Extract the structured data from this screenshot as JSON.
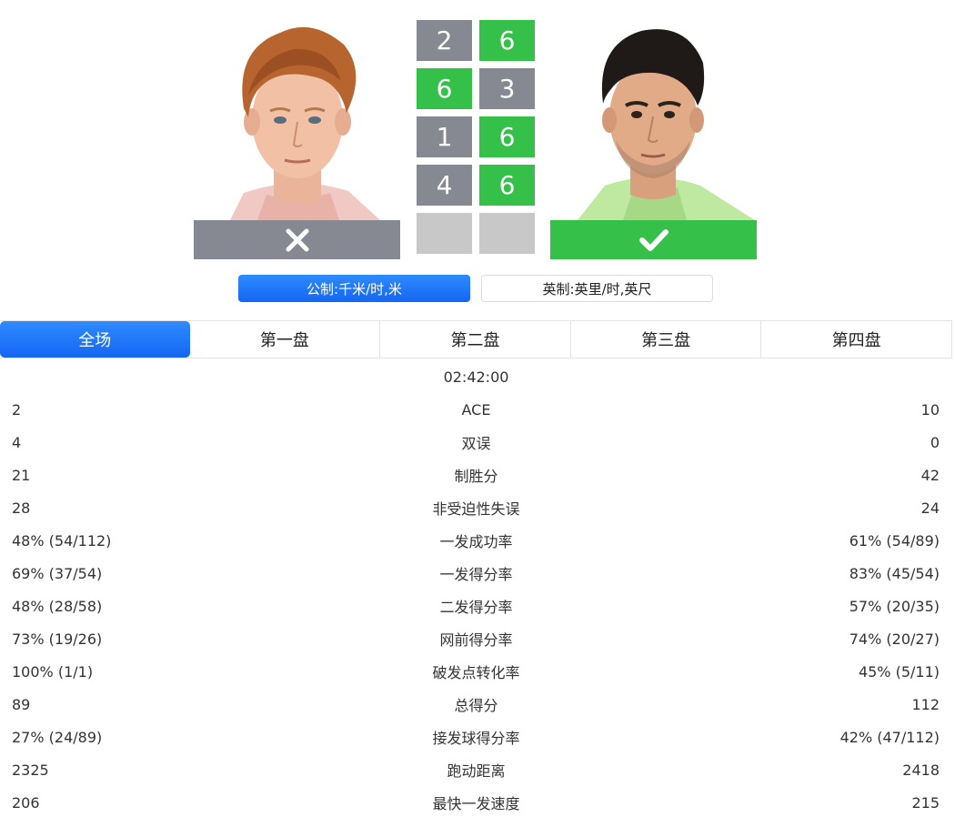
{
  "players": {
    "left": {
      "result": "loss",
      "result_icon": "close-icon"
    },
    "right": {
      "result": "win",
      "result_icon": "check-icon"
    }
  },
  "sets": [
    {
      "left": "2",
      "right": "6",
      "winner": "right"
    },
    {
      "left": "6",
      "right": "3",
      "winner": "left"
    },
    {
      "left": "1",
      "right": "6",
      "winner": "right"
    },
    {
      "left": "4",
      "right": "6",
      "winner": "right"
    },
    {
      "left": "",
      "right": "",
      "winner": "none"
    }
  ],
  "units": {
    "metric_label": "公制:千米/时,米",
    "imperial_label": "英制:英里/时,英尺",
    "selected": "metric"
  },
  "tabs": [
    "全场",
    "第一盘",
    "第二盘",
    "第三盘",
    "第四盘"
  ],
  "selected_tab": 0,
  "duration": "02:42:00",
  "stats": [
    {
      "left": "2",
      "label": "ACE",
      "right": "10"
    },
    {
      "left": "4",
      "label": "双误",
      "right": "0"
    },
    {
      "left": "21",
      "label": "制胜分",
      "right": "42"
    },
    {
      "left": "28",
      "label": "非受迫性失误",
      "right": "24"
    },
    {
      "left": "48% (54/112)",
      "label": "一发成功率",
      "right": "61% (54/89)"
    },
    {
      "left": "69% (37/54)",
      "label": "一发得分率",
      "right": "83% (45/54)"
    },
    {
      "left": "48% (28/58)",
      "label": "二发得分率",
      "right": "57% (20/35)"
    },
    {
      "left": "73% (19/26)",
      "label": "网前得分率",
      "right": "74% (20/27)"
    },
    {
      "left": "100% (1/1)",
      "label": "破发点转化率",
      "right": "45% (5/11)"
    },
    {
      "left": "89",
      "label": "总得分",
      "right": "112"
    },
    {
      "left": "27% (24/89)",
      "label": "接发球得分率",
      "right": "42% (47/112)"
    },
    {
      "left": "2325",
      "label": "跑动距离",
      "right": "2418"
    },
    {
      "left": "206",
      "label": "最快一发速度",
      "right": "215"
    }
  ],
  "colors": {
    "win": "#35c04a",
    "loss": "#868892",
    "empty": "#c8c8c8",
    "accent": "#1e73f7"
  }
}
